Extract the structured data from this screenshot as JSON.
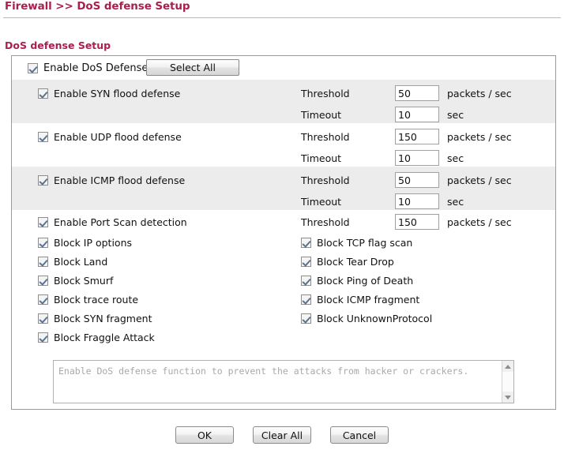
{
  "breadcrumb": "Firewall >> DoS defense Setup",
  "section_title": "DoS defense Setup",
  "colors": {
    "accent": "#A8214E",
    "row_shade": "#ececec",
    "panel_border": "#9a9a9a",
    "check_mark": "#5b7392"
  },
  "master": {
    "label": "Enable DoS Defense",
    "checked": true,
    "select_all_label": "Select All"
  },
  "defense_rows": [
    {
      "label": "Enable SYN flood defense",
      "checked": true,
      "shaded": true,
      "fields": [
        {
          "label": "Threshold",
          "value": "50",
          "unit": "packets / sec"
        },
        {
          "label": "Timeout",
          "value": "10",
          "unit": "sec"
        }
      ]
    },
    {
      "label": "Enable UDP flood defense",
      "checked": true,
      "shaded": false,
      "fields": [
        {
          "label": "Threshold",
          "value": "150",
          "unit": "packets / sec"
        },
        {
          "label": "Timeout",
          "value": "10",
          "unit": "sec"
        }
      ]
    },
    {
      "label": "Enable ICMP flood defense",
      "checked": true,
      "shaded": true,
      "fields": [
        {
          "label": "Threshold",
          "value": "50",
          "unit": "packets / sec"
        },
        {
          "label": "Timeout",
          "value": "10",
          "unit": "sec"
        }
      ]
    },
    {
      "label": "Enable Port Scan detection",
      "checked": true,
      "shaded": false,
      "fields": [
        {
          "label": "Threshold",
          "value": "150",
          "unit": "packets / sec"
        }
      ]
    }
  ],
  "block_options": {
    "left_column": [
      {
        "label": "Block IP options",
        "checked": true
      },
      {
        "label": "Block Land",
        "checked": true
      },
      {
        "label": "Block Smurf",
        "checked": true
      },
      {
        "label": "Block trace route",
        "checked": true
      },
      {
        "label": "Block SYN fragment",
        "checked": true
      },
      {
        "label": "Block Fraggle Attack",
        "checked": true
      }
    ],
    "right_column": [
      {
        "label": "Block TCP flag scan",
        "checked": true
      },
      {
        "label": "Block Tear Drop",
        "checked": true
      },
      {
        "label": "Block Ping of Death",
        "checked": true
      },
      {
        "label": "Block ICMP fragment",
        "checked": true
      },
      {
        "label": "Block UnknownProtocol",
        "checked": true
      }
    ]
  },
  "description": {
    "text": "Enable DoS defense function to prevent the attacks from hacker or crackers."
  },
  "footer": {
    "ok_label": "OK",
    "clear_all_label": "Clear All",
    "cancel_label": "Cancel"
  }
}
